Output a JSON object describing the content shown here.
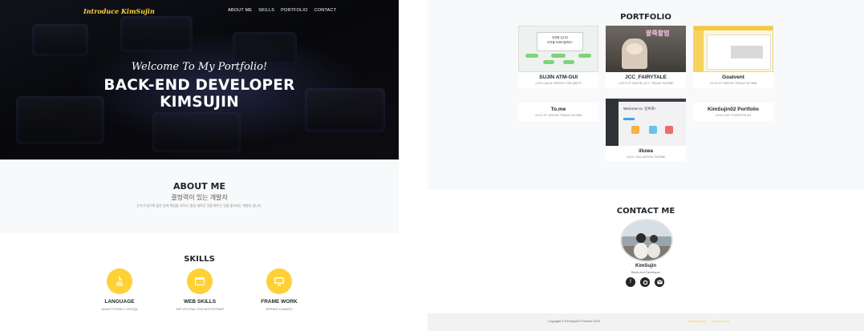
{
  "navbar": {
    "brand": "Introduce KimSujin",
    "links": [
      "ABOUT ME",
      "SKILLS",
      "PORTFOLIO",
      "CONTACT"
    ]
  },
  "hero": {
    "subheading": "Welcome To My Portfolio!",
    "heading_line1": "BACK-END DEVELOPER",
    "heading_line2": "KIMSUJIN"
  },
  "about": {
    "title": "ABOUT ME",
    "subtitle": "결정력이 있는 개발자",
    "text": "끈기가 있으며 맡은 일에 책임을 다하고, 항상 새로운 것을 배우는 것을 좋아하는 개발자 입니다."
  },
  "skills": {
    "title": "SKILLS",
    "items": [
      {
        "name": "LANGUAGE",
        "desc": "JAVA PYTHON C MYSQL",
        "icon": "java-icon"
      },
      {
        "name": "WEB SKILLS",
        "desc": "JSP JS HTML CSS BOOTSTRAP",
        "icon": "browser-icon"
      },
      {
        "name": "FRAME WORK",
        "desc": "SPRING DJANGO",
        "icon": "monitor-icon"
      }
    ]
  },
  "portfolio": {
    "title": "PORTFOLIO",
    "items": [
      {
        "title": "SUJIN ATM-GUI",
        "subtitle": "2019 JAVA SWING PROJECT"
      },
      {
        "title": "JCC_FAIRYTALE",
        "subtitle": "2019 IT SHOW JCC TEAM WORK"
      },
      {
        "title": "Goalvent",
        "subtitle": "2020 IT SHOW TEAM WORK"
      },
      {
        "title": "To.me",
        "subtitle": "2020 IT SHOW TEAM WORK"
      },
      {
        "title": "illuwa",
        "subtitle": "2020 VACATION WORK"
      },
      {
        "title": "KimSujin02 Portfolio",
        "subtitle": "2020 MY PORTFOLIO"
      }
    ],
    "thumb_text": {
      "atm_line1": "무언함 입니다",
      "atm_line2": "무엇을 도와드릴까요?",
      "fairytale_logo": "팥죽할멈",
      "illuwa_banner": "Welcome to, 일루와!"
    }
  },
  "contact": {
    "title": "CONTACT ME",
    "name": "KimSujin",
    "role": "Back-end Developer"
  },
  "footer": {
    "copyright": "Copyright © KimSujin02 Portfolio 2020",
    "links": [
      "Privacy Policy",
      "Terms of Use"
    ]
  },
  "colors": {
    "accent": "#fed136",
    "dark": "#212529",
    "section_bg": "#f8f9fa"
  }
}
